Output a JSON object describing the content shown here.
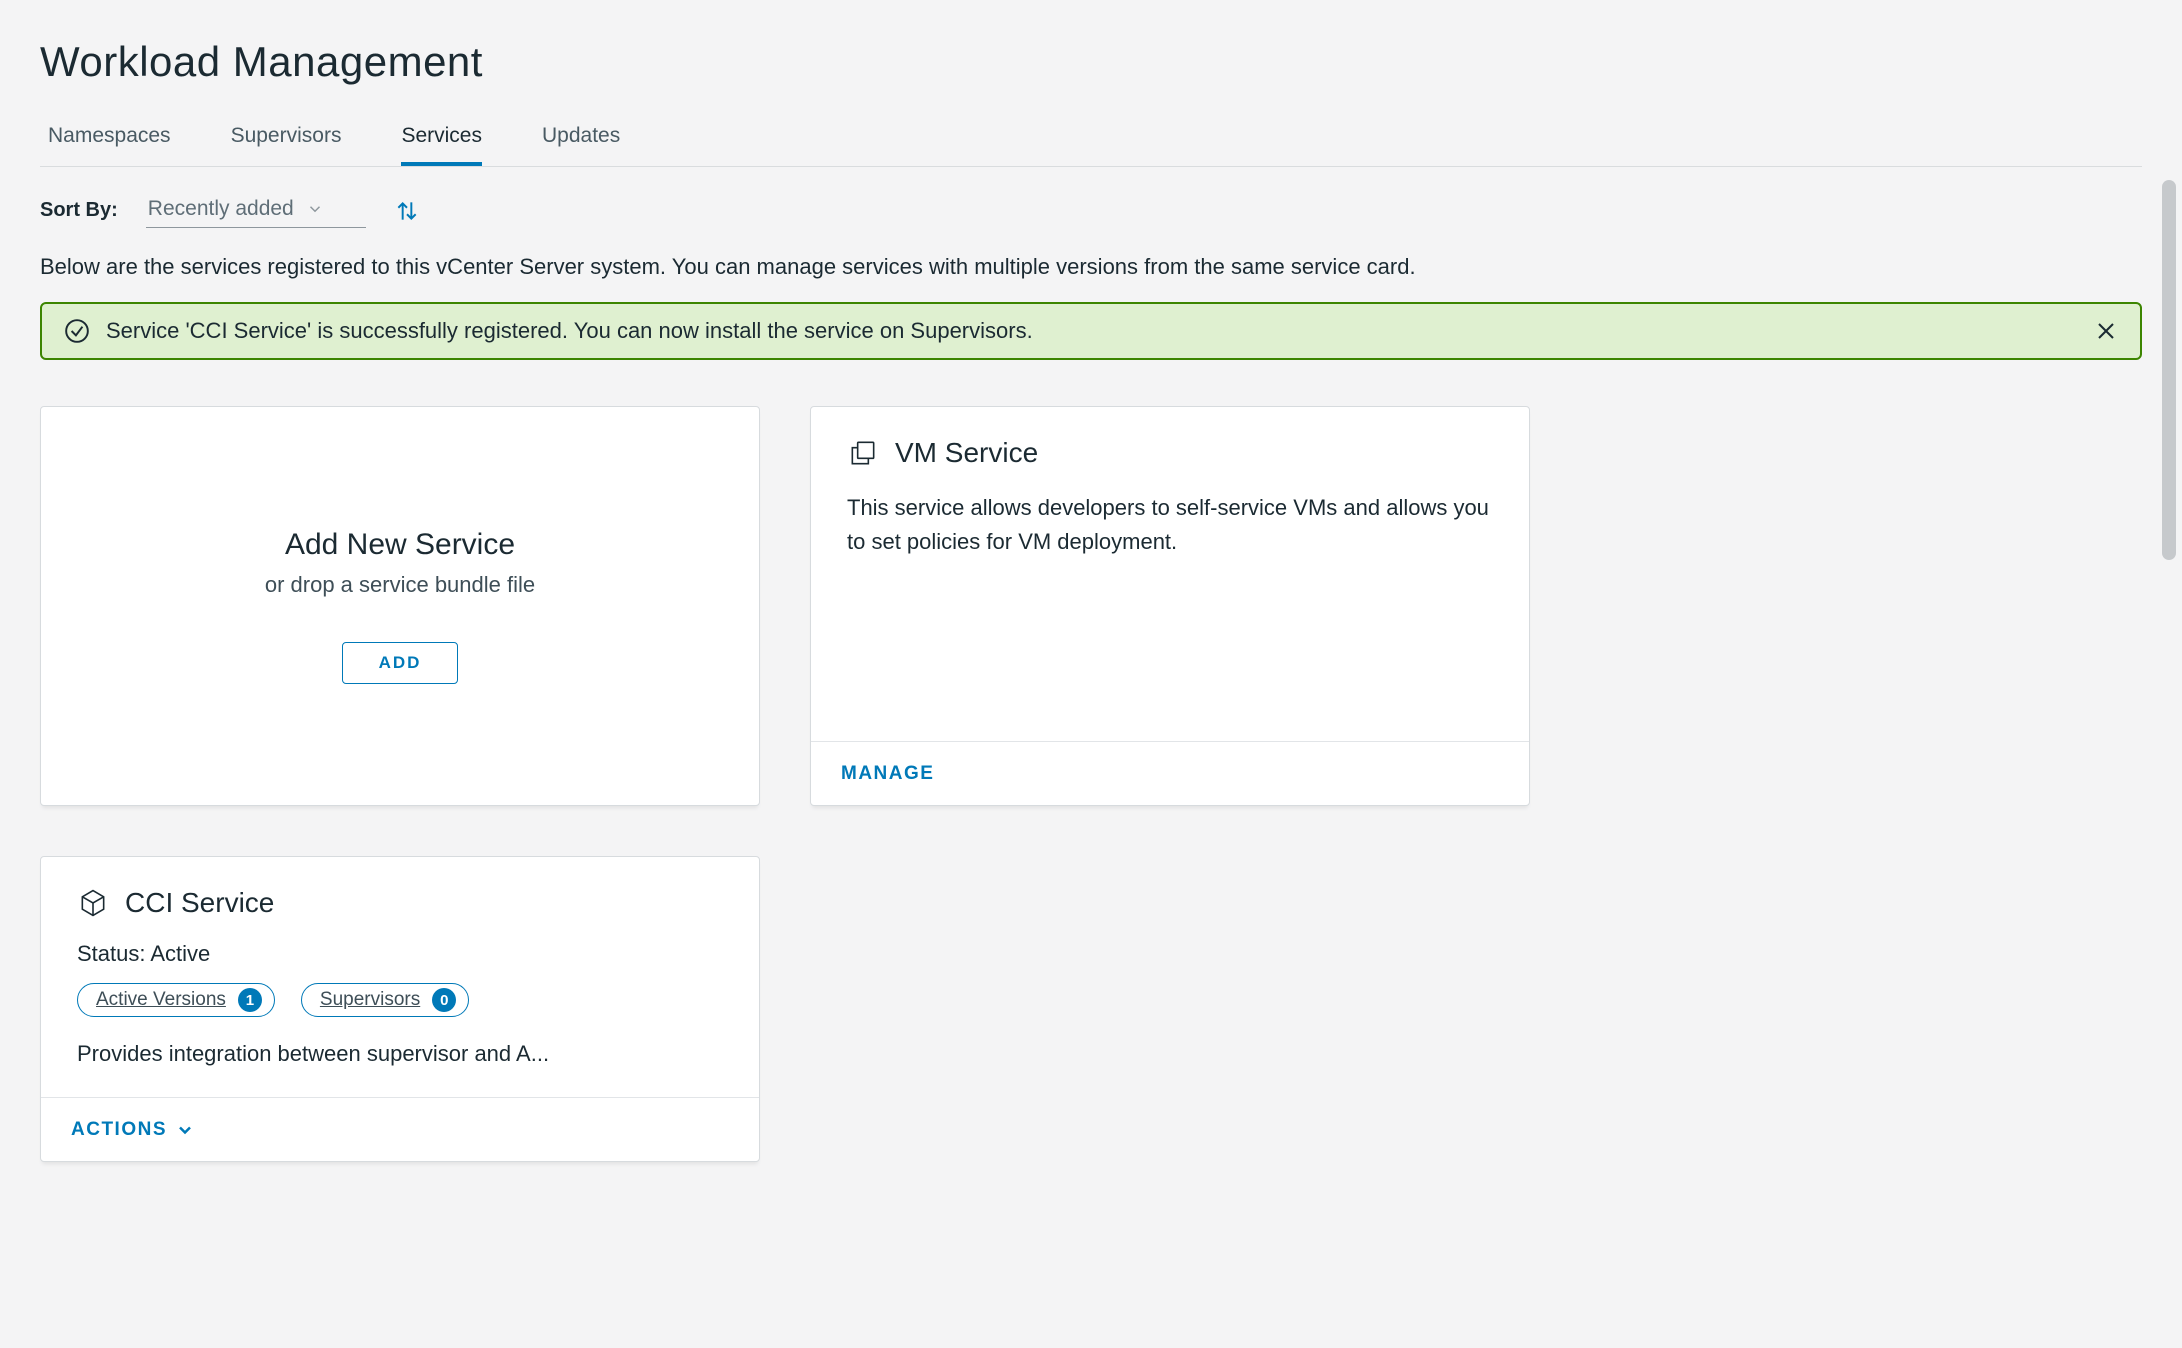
{
  "header": {
    "title": "Workload Management"
  },
  "tabs": {
    "items": [
      {
        "label": "Namespaces"
      },
      {
        "label": "Supervisors"
      },
      {
        "label": "Services"
      },
      {
        "label": "Updates"
      }
    ],
    "active_index": 2
  },
  "sort": {
    "label": "Sort By:",
    "value": "Recently added"
  },
  "description": "Below are the services registered to this vCenter Server system. You can manage services with multiple versions from the same service card.",
  "banner": {
    "icon": "check-circle-icon",
    "message": "Service 'CCI Service' is successfully registered. You can now install the service on Supervisors.",
    "close_icon": "close-icon"
  },
  "add_card": {
    "title": "Add New Service",
    "subtitle": "or drop a service bundle file",
    "button": "ADD"
  },
  "vm_card": {
    "icon": "vm-icon",
    "title": "VM Service",
    "description": "This service allows developers to self-service VMs and allows you to set policies for VM deployment.",
    "footer_action": "MANAGE"
  },
  "cci_card": {
    "icon": "cube-icon",
    "title": "CCI Service",
    "status_label": "Status: Active",
    "pills": [
      {
        "label": "Active Versions",
        "count": "1"
      },
      {
        "label": "Supervisors",
        "count": "0"
      }
    ],
    "description": "Provides integration between supervisor and A...",
    "footer_action": "ACTIONS"
  }
}
